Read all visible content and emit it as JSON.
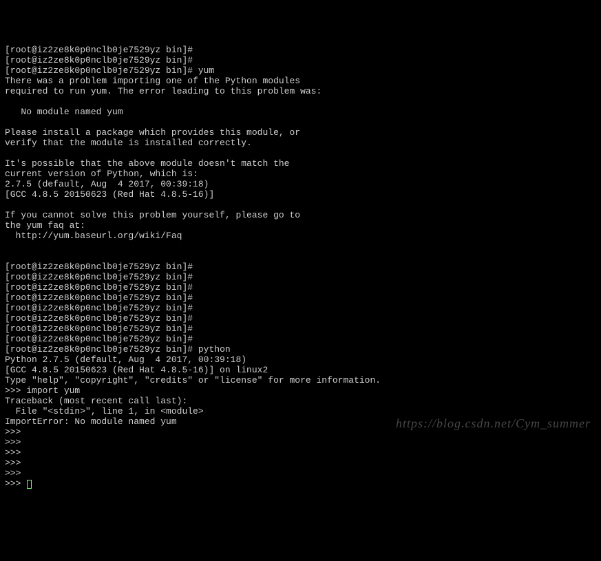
{
  "prompt_base": "[root@iz2ze8k0p0nclb0je7529yz bin]#",
  "cmd_yum": "yum",
  "cmd_python": "python",
  "yum_error": {
    "l1": "There was a problem importing one of the Python modules",
    "l2": "required to run yum. The error leading to this problem was:",
    "l3": "   No module named yum",
    "l4": "Please install a package which provides this module, or",
    "l5": "verify that the module is installed correctly.",
    "l6": "It's possible that the above module doesn't match the",
    "l7": "current version of Python, which is:",
    "l8": "2.7.5 (default, Aug  4 2017, 00:39:18)",
    "l9": "[GCC 4.8.5 20150623 (Red Hat 4.8.5-16)]",
    "l10": "If you cannot solve this problem yourself, please go to",
    "l11": "the yum faq at:",
    "l12": "  http://yum.baseurl.org/wiki/Faq"
  },
  "python": {
    "banner1": "Python 2.7.5 (default, Aug  4 2017, 00:39:18)",
    "banner2": "[GCC 4.8.5 20150623 (Red Hat 4.8.5-16)] on linux2",
    "banner3": "Type \"help\", \"copyright\", \"credits\" or \"license\" for more information.",
    "prompt": ">>>",
    "stmt_import": "import yum",
    "tb1": "Traceback (most recent call last):",
    "tb2": "  File \"<stdin>\", line 1, in <module>",
    "tb3": "ImportError: No module named yum"
  },
  "watermark": "https://blog.csdn.net/Cym_summer"
}
